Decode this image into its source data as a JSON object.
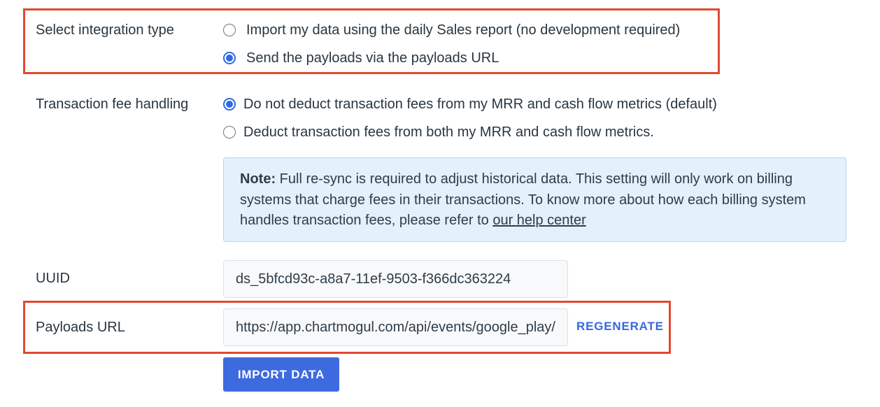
{
  "integration_type": {
    "label": "Select integration type",
    "options": [
      {
        "label": "Import my data using the daily Sales report (no development required)",
        "checked": false
      },
      {
        "label": "Send the payloads via the payloads URL",
        "checked": true
      }
    ]
  },
  "transaction_fee": {
    "label": "Transaction fee handling",
    "options": [
      {
        "label": "Do not deduct transaction fees from my MRR and cash flow metrics (default)",
        "checked": true
      },
      {
        "label": "Deduct transaction fees from both my MRR and cash flow metrics.",
        "checked": false
      }
    ],
    "note": {
      "bold": "Note:",
      "text": " Full re-sync is required to adjust historical data. This setting will only work on billing systems that charge fees in their transactions. To know more about how each billing system handles transaction fees, please refer to ",
      "link": "our help center"
    }
  },
  "uuid": {
    "label": "UUID",
    "value": "ds_5bfcd93c-a8a7-11ef-9503-f366dc363224"
  },
  "payloads_url": {
    "label": "Payloads URL",
    "value": "https://app.chartmogul.com/api/events/google_play/",
    "regenerate_label": "REGENERATE"
  },
  "import_button": {
    "label": "IMPORT DATA"
  },
  "colors": {
    "accent": "#3e6ae0",
    "highlight": "#e04a2f",
    "note_bg": "#e2f1fc"
  }
}
